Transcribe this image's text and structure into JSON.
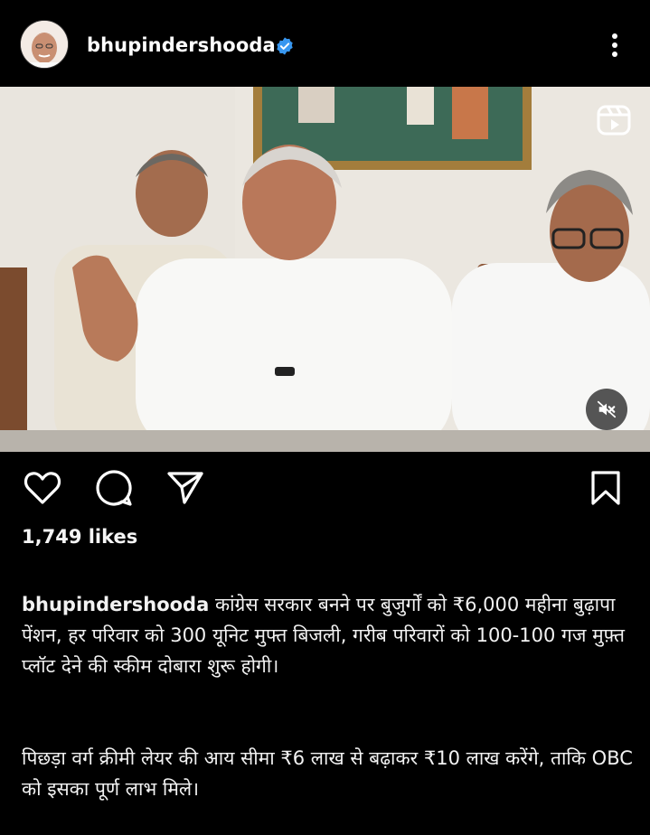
{
  "post": {
    "username": "bhupindershooda",
    "likes": "1,749 likes",
    "caption_p1": "कांग्रेस सरकार बनने पर बुजुर्गों को ₹6,000 महीना बुढ़ापा पेंशन, हर परिवार को 300 यूनिट मुफ्त बिजली, गरीब परिवारों को 100-100 गज मुफ़्त प्लॉट देने की स्कीम दोबारा शुरू होगी।",
    "caption_p2": "पिछड़ा वर्ग क्रीमी लेयर की आय सीमा ₹6 लाख से बढ़ाकर ₹10 लाख करेंगे, ताकि OBC को इसका पूर्ण लाभ मिले।"
  },
  "icons": {
    "verified": "verified-badge-icon",
    "more": "more-options-icon",
    "reel": "reel-icon",
    "mute": "speaker-muted-icon",
    "like": "heart-icon",
    "comment": "comment-icon",
    "share": "send-icon",
    "save": "bookmark-icon"
  },
  "colors": {
    "background": "#000000",
    "text": "#f5f5f5",
    "verified": "#3897f0"
  }
}
